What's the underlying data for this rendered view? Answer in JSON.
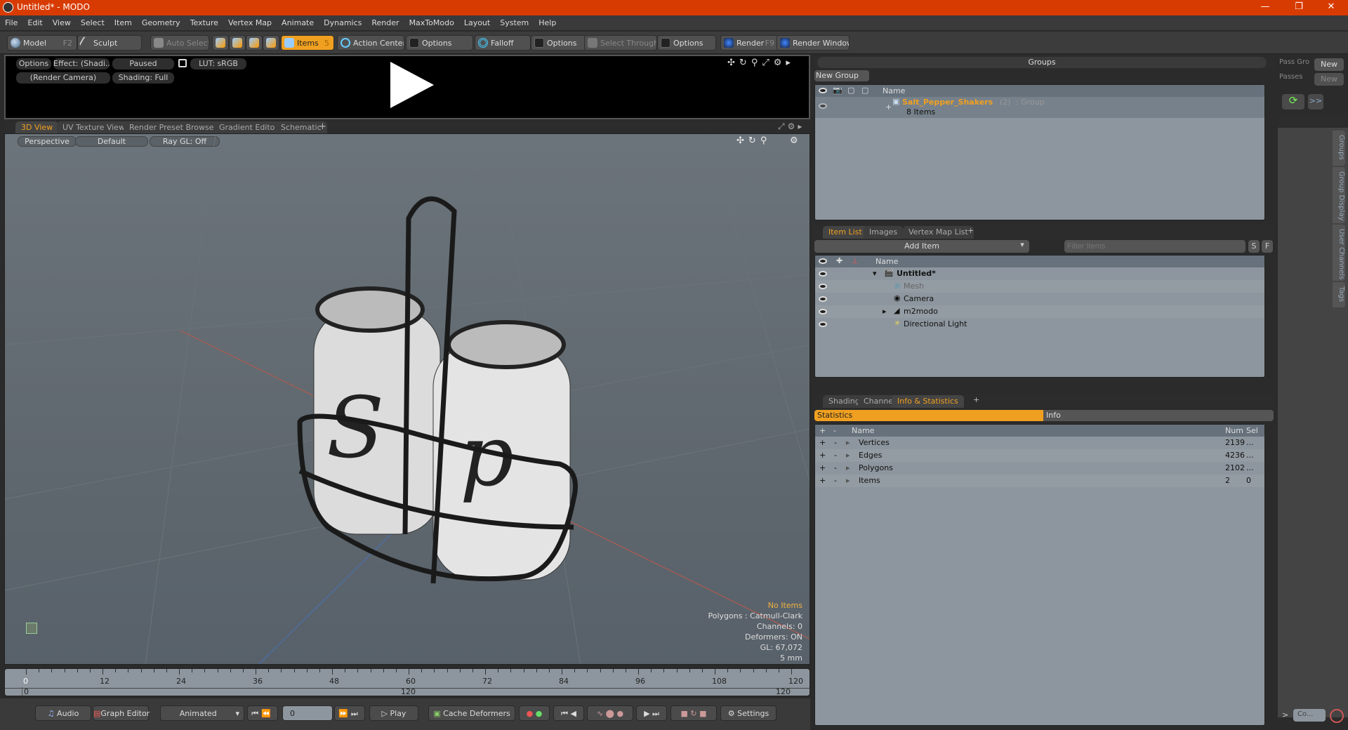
{
  "window": {
    "title": "Untitled* - MODO",
    "controls": [
      "minimize",
      "restore",
      "close"
    ]
  },
  "menu": [
    "File",
    "Edit",
    "View",
    "Select",
    "Item",
    "Geometry",
    "Texture",
    "Vertex Map",
    "Animate",
    "Dynamics",
    "Render",
    "MaxToModo",
    "Layout",
    "System",
    "Help"
  ],
  "toolbar": {
    "model": "Model",
    "model_key": "F2",
    "sculpt": "Sculpt",
    "auto_select": "Auto Select",
    "items": "Items",
    "items_key": "5",
    "action_center": "Action Center",
    "options1": "Options",
    "falloff": "Falloff",
    "options2": "Options",
    "select_through": "Select Through",
    "options3": "Options",
    "render": "Render",
    "render_key": "F9",
    "render_window": "Render Window"
  },
  "render_preview": {
    "options": "Options",
    "effect": "Effect: (Shadi...",
    "paused": "Paused",
    "lut": "LUT: sRGB",
    "camera": "(Render Camera)",
    "shading": "Shading: Full"
  },
  "viewport_tabs": [
    {
      "label": "3D View",
      "active": true
    },
    {
      "label": "UV Texture View"
    },
    {
      "label": "Render Preset Browser"
    },
    {
      "label": "Gradient Editor"
    },
    {
      "label": "Schematic"
    }
  ],
  "viewport": {
    "projection": "Perspective",
    "style": "Default",
    "raygl": "Ray GL: Off",
    "info": {
      "selection": "No Items",
      "polygons": "Polygons : Catmull-Clark",
      "channels": "Channels: 0",
      "deformers": "Deformers: ON",
      "gl": "GL: 67,072",
      "unit": "5 mm"
    }
  },
  "groups": {
    "title": "Groups",
    "new_group": "New Group",
    "col_name": "Name",
    "rows": [
      {
        "name": "Salt_Pepper_Shakers",
        "count": "(2)",
        "type": ": Group",
        "sub": "8 Items"
      }
    ]
  },
  "passes": {
    "pass_groups": "Pass Gro",
    "passes": "Passes",
    "new": "New",
    "forward": ">>"
  },
  "side_tabs": [
    "Groups",
    "Group Display",
    "User Channels",
    "Tags"
  ],
  "item_list": {
    "tabs": [
      {
        "label": "Item List",
        "active": true
      },
      {
        "label": "Images"
      },
      {
        "label": "Vertex Map List"
      }
    ],
    "add_item": "Add Item",
    "filter_placeholder": "Filter Items",
    "s": "S",
    "f": "F",
    "col_name": "Name",
    "items": [
      {
        "name": "Untitled*",
        "kind": "scene"
      },
      {
        "name": "Mesh",
        "kind": "mesh"
      },
      {
        "name": "Camera",
        "kind": "camera"
      },
      {
        "name": "m2modo",
        "kind": "group"
      },
      {
        "name": "Directional Light",
        "kind": "light"
      }
    ]
  },
  "stats": {
    "tabs": [
      {
        "label": "Shading"
      },
      {
        "label": "Channels"
      },
      {
        "label": "Info & Statistics",
        "active": true
      }
    ],
    "subtabs": {
      "statistics": "Statistics",
      "info": "Info"
    },
    "cols": {
      "plus": "+",
      "minus": "-",
      "name": "Name",
      "num": "Num",
      "sel": "Sel"
    },
    "rows": [
      {
        "name": "Vertices",
        "num": "2139",
        "sel": "..."
      },
      {
        "name": "Edges",
        "num": "4236",
        "sel": "..."
      },
      {
        "name": "Polygons",
        "num": "2102",
        "sel": "..."
      },
      {
        "name": "Items",
        "num": "2",
        "sel": "0"
      }
    ]
  },
  "timeline": {
    "ticks": [
      "0",
      "12",
      "24",
      "36",
      "48",
      "60",
      "72",
      "84",
      "96",
      "108",
      "120"
    ],
    "start": "0",
    "end_mid": "120",
    "end": "120"
  },
  "transport": {
    "audio": "Audio",
    "graph_editor": "Graph Editor",
    "mode": "Animated",
    "frame": "0",
    "play": "Play",
    "cache": "Cache Deformers",
    "settings": "Settings"
  },
  "command": {
    "prompt": ">",
    "placeholder": "Co..."
  }
}
